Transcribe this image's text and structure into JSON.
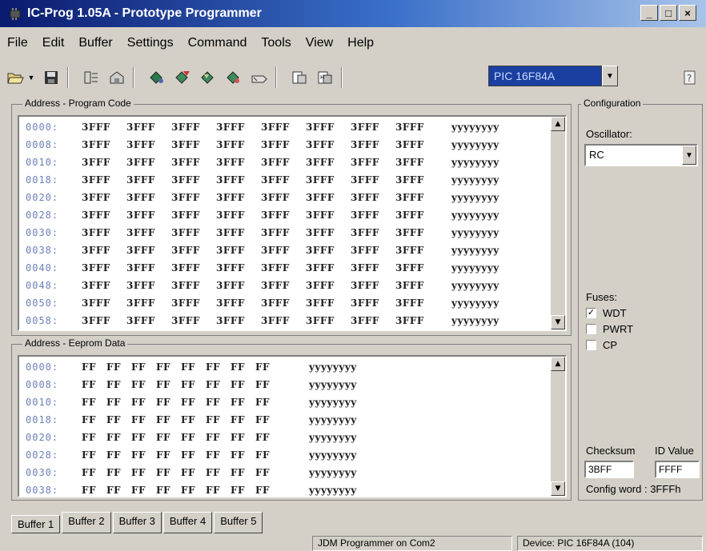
{
  "window": {
    "title": "IC-Prog 1.05A - Prototype Programmer",
    "min": "_",
    "max": "□",
    "close": "×"
  },
  "menu": [
    "File",
    "Edit",
    "Buffer",
    "Settings",
    "Command",
    "Tools",
    "View",
    "Help"
  ],
  "toolbar": {
    "device": "PIC 16F84A",
    "icons": [
      "open-icon",
      "save-icon",
      "buffer-icon",
      "settings-icon",
      "read-chip-icon",
      "program-chip-icon",
      "program-all-icon",
      "verify-icon",
      "erase-icon",
      "buffer-view-icon",
      "buffer-compare-icon",
      "help-icon"
    ]
  },
  "program": {
    "title": "Address - Program Code",
    "rows": [
      {
        "addr": "0000:",
        "words": [
          "3FFF",
          "3FFF",
          "3FFF",
          "3FFF",
          "3FFF",
          "3FFF",
          "3FFF",
          "3FFF"
        ],
        "ascii": "yyyyyyyy"
      },
      {
        "addr": "0008:",
        "words": [
          "3FFF",
          "3FFF",
          "3FFF",
          "3FFF",
          "3FFF",
          "3FFF",
          "3FFF",
          "3FFF"
        ],
        "ascii": "yyyyyyyy"
      },
      {
        "addr": "0010:",
        "words": [
          "3FFF",
          "3FFF",
          "3FFF",
          "3FFF",
          "3FFF",
          "3FFF",
          "3FFF",
          "3FFF"
        ],
        "ascii": "yyyyyyyy"
      },
      {
        "addr": "0018:",
        "words": [
          "3FFF",
          "3FFF",
          "3FFF",
          "3FFF",
          "3FFF",
          "3FFF",
          "3FFF",
          "3FFF"
        ],
        "ascii": "yyyyyyyy"
      },
      {
        "addr": "0020:",
        "words": [
          "3FFF",
          "3FFF",
          "3FFF",
          "3FFF",
          "3FFF",
          "3FFF",
          "3FFF",
          "3FFF"
        ],
        "ascii": "yyyyyyyy"
      },
      {
        "addr": "0028:",
        "words": [
          "3FFF",
          "3FFF",
          "3FFF",
          "3FFF",
          "3FFF",
          "3FFF",
          "3FFF",
          "3FFF"
        ],
        "ascii": "yyyyyyyy"
      },
      {
        "addr": "0030:",
        "words": [
          "3FFF",
          "3FFF",
          "3FFF",
          "3FFF",
          "3FFF",
          "3FFF",
          "3FFF",
          "3FFF"
        ],
        "ascii": "yyyyyyyy"
      },
      {
        "addr": "0038:",
        "words": [
          "3FFF",
          "3FFF",
          "3FFF",
          "3FFF",
          "3FFF",
          "3FFF",
          "3FFF",
          "3FFF"
        ],
        "ascii": "yyyyyyyy"
      },
      {
        "addr": "0040:",
        "words": [
          "3FFF",
          "3FFF",
          "3FFF",
          "3FFF",
          "3FFF",
          "3FFF",
          "3FFF",
          "3FFF"
        ],
        "ascii": "yyyyyyyy"
      },
      {
        "addr": "0048:",
        "words": [
          "3FFF",
          "3FFF",
          "3FFF",
          "3FFF",
          "3FFF",
          "3FFF",
          "3FFF",
          "3FFF"
        ],
        "ascii": "yyyyyyyy"
      },
      {
        "addr": "0050:",
        "words": [
          "3FFF",
          "3FFF",
          "3FFF",
          "3FFF",
          "3FFF",
          "3FFF",
          "3FFF",
          "3FFF"
        ],
        "ascii": "yyyyyyyy"
      },
      {
        "addr": "0058:",
        "words": [
          "3FFF",
          "3FFF",
          "3FFF",
          "3FFF",
          "3FFF",
          "3FFF",
          "3FFF",
          "3FFF"
        ],
        "ascii": "yyyyyyyy"
      }
    ]
  },
  "eeprom": {
    "title": "Address - Eeprom Data",
    "rows": [
      {
        "addr": "0000:",
        "words": [
          "FF",
          "FF",
          "FF",
          "FF",
          "FF",
          "FF",
          "FF",
          "FF"
        ],
        "ascii": "yyyyyyyy"
      },
      {
        "addr": "0008:",
        "words": [
          "FF",
          "FF",
          "FF",
          "FF",
          "FF",
          "FF",
          "FF",
          "FF"
        ],
        "ascii": "yyyyyyyy"
      },
      {
        "addr": "0010:",
        "words": [
          "FF",
          "FF",
          "FF",
          "FF",
          "FF",
          "FF",
          "FF",
          "FF"
        ],
        "ascii": "yyyyyyyy"
      },
      {
        "addr": "0018:",
        "words": [
          "FF",
          "FF",
          "FF",
          "FF",
          "FF",
          "FF",
          "FF",
          "FF"
        ],
        "ascii": "yyyyyyyy"
      },
      {
        "addr": "0020:",
        "words": [
          "FF",
          "FF",
          "FF",
          "FF",
          "FF",
          "FF",
          "FF",
          "FF"
        ],
        "ascii": "yyyyyyyy"
      },
      {
        "addr": "0028:",
        "words": [
          "FF",
          "FF",
          "FF",
          "FF",
          "FF",
          "FF",
          "FF",
          "FF"
        ],
        "ascii": "yyyyyyyy"
      },
      {
        "addr": "0030:",
        "words": [
          "FF",
          "FF",
          "FF",
          "FF",
          "FF",
          "FF",
          "FF",
          "FF"
        ],
        "ascii": "yyyyyyyy"
      },
      {
        "addr": "0038:",
        "words": [
          "FF",
          "FF",
          "FF",
          "FF",
          "FF",
          "FF",
          "FF",
          "FF"
        ],
        "ascii": "yyyyyyyy"
      }
    ]
  },
  "config": {
    "title": "Configuration",
    "oscillator_label": "Oscillator:",
    "oscillator_value": "RC",
    "fuses_label": "Fuses:",
    "fuses": [
      {
        "label": "WDT",
        "checked": true
      },
      {
        "label": "PWRT",
        "checked": false
      },
      {
        "label": "CP",
        "checked": false
      }
    ],
    "checksum_label": "Checksum",
    "id_label": "ID Value",
    "checksum_value": "3BFF",
    "id_value": "FFFF",
    "config_word": "Config word : 3FFFh"
  },
  "tabs": [
    "Buffer 1",
    "Buffer 2",
    "Buffer 3",
    "Buffer 4",
    "Buffer 5"
  ],
  "active_tab": 0,
  "status": {
    "programmer": "JDM Programmer on Com2",
    "device": "Device: PIC 16F84A  (104)"
  },
  "colors": {
    "title_start": "#0a1a6e",
    "title_end": "#a8c4ea",
    "address": "#6d7fb8",
    "device_bg": "#1a3fa0"
  }
}
